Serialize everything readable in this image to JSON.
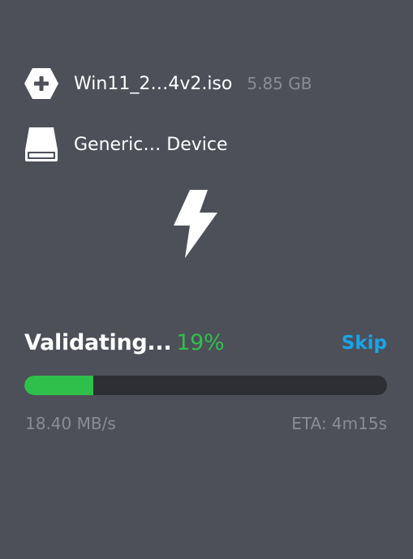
{
  "image": {
    "icon": "image-add-icon",
    "name": "Win11_2…4v2.iso",
    "size": "5.85 GB"
  },
  "drive": {
    "icon": "drive-icon",
    "name": "Generic… Device"
  },
  "flash_icon": "lightning-bolt-icon",
  "progress": {
    "status_label": "Validating...",
    "percent_label": "19%",
    "percent": 19,
    "skip_label": "Skip",
    "speed": "18.40 MB/s",
    "eta": "ETA: 4m15s"
  },
  "colors": {
    "background": "#4d5059",
    "accent_green": "#2fc04b",
    "accent_blue": "#1aa4e8",
    "bar_track": "#2e2f34",
    "muted_text": "#8a8d93"
  }
}
